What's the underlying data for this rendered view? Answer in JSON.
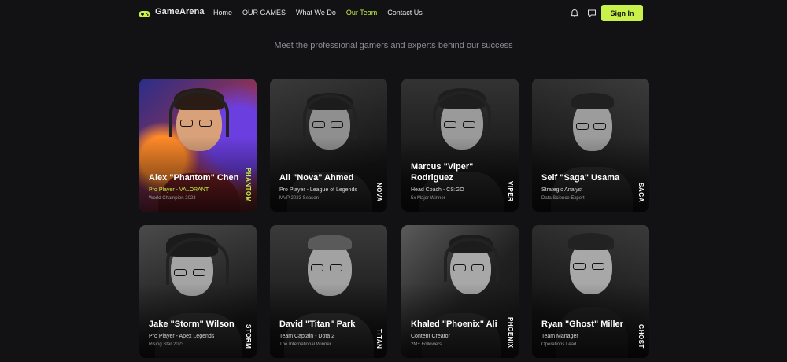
{
  "brand": {
    "name": "GameArena"
  },
  "nav": {
    "items": [
      "Home",
      "OUR GAMES",
      "What We Do",
      "Our Team",
      "Contact Us"
    ],
    "active": "Our Team",
    "signin_label": "Sign In"
  },
  "subtitle": "Meet the professional gamers and experts behind our success",
  "team": [
    {
      "name": "Alex \"Phantom\" Chen",
      "role": "Pro Player - VALORANT",
      "achievement": "World Champion 2023",
      "tag": "PHANTOM",
      "featured": true
    },
    {
      "name": "Ali \"Nova\" Ahmed",
      "role": "Pro Player - League of Legends",
      "achievement": "MVP 2023 Season",
      "tag": "NOVA"
    },
    {
      "name": "Marcus \"Viper\" Rodriguez",
      "role": "Head Coach - CS:GO",
      "achievement": "5x Major Winner",
      "tag": "VIPER"
    },
    {
      "name": "Seif \"Saga\" Usama",
      "role": "Strategic Analyst",
      "achievement": "Data Science Expert",
      "tag": "SAGA"
    },
    {
      "name": "Jake \"Storm\" Wilson",
      "role": "Pro Player - Apex Legends",
      "achievement": "Rising Star 2023",
      "tag": "STORM"
    },
    {
      "name": "David \"Titan\" Park",
      "role": "Team Captain - Dota 2",
      "achievement": "The International Winner",
      "tag": "TITAN"
    },
    {
      "name": "Khaled \"Phoenix\" Ali",
      "role": "Content Creator",
      "achievement": "2M+ Followers",
      "tag": "PHOENIX"
    },
    {
      "name": "Ryan \"Ghost\" Miller",
      "role": "Team Manager",
      "achievement": "Operations Lead",
      "tag": "GHOST"
    }
  ],
  "colors": {
    "accent": "#c8f24a",
    "background": "#121215"
  }
}
